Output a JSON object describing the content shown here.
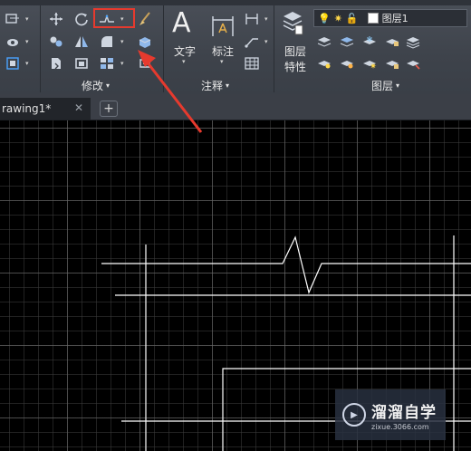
{
  "ribbon": {
    "panels": {
      "modify_label": "修改",
      "annotation_label": "注释",
      "layers_label": "图层"
    },
    "text_tool_label": "文字",
    "dimension_tool_label": "标注",
    "layer_properties_label_line1": "图层",
    "layer_properties_label_line2": "特性",
    "layer_combo_value": "图层1",
    "dropdown_glyph": "▾",
    "big_text_glyph": "A"
  },
  "tabs": {
    "document_tab": "rawing1*",
    "close_glyph": "✕",
    "new_tab_glyph": "+"
  },
  "watermark": {
    "title": "溜溜自学",
    "url": "zixue.3066.com"
  },
  "colors": {
    "ribbon_bg": "#3e434b",
    "canvas_bg": "#000000",
    "highlight": "#e63a2e",
    "drawing_line": "#ffffff"
  }
}
